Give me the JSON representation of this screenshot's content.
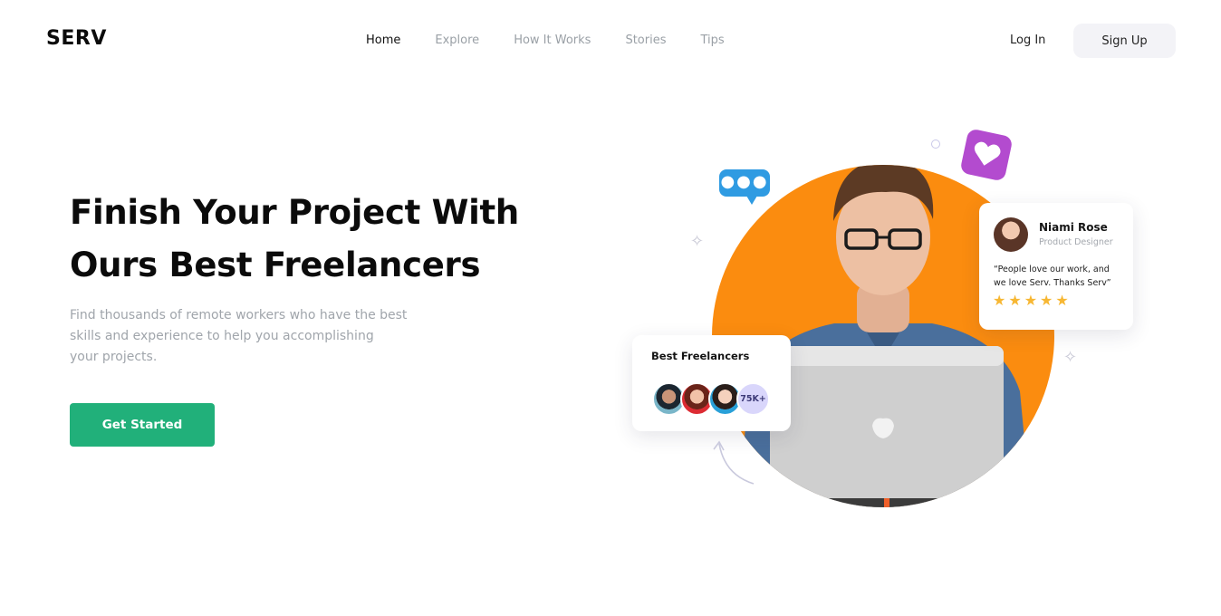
{
  "brand": {
    "logo": "SERV"
  },
  "nav": {
    "items": [
      {
        "label": "Home",
        "active": true
      },
      {
        "label": "Explore",
        "active": false
      },
      {
        "label": "How It Works",
        "active": false
      },
      {
        "label": "Stories",
        "active": false
      },
      {
        "label": "Tips",
        "active": false
      }
    ]
  },
  "auth": {
    "login_label": "Log In",
    "signup_label": "Sign Up"
  },
  "hero": {
    "headline_lines": [
      "Finish Your Project With",
      "Ours Best Freelancers"
    ],
    "subtitle_lines": [
      "Find thousands of remote workers who have the best",
      "skills and experience to help you accomplishing",
      "your projects."
    ],
    "cta_label": "Get Started"
  },
  "review": {
    "name": "Niami Rose",
    "role": "Product Designer",
    "quote_lines": [
      "“People love our work, and",
      "we love Serv. Thanks Serv”"
    ],
    "stars": "★★★★★",
    "rating": 5
  },
  "freelancers": {
    "title": "Best Freelancers",
    "count_badge": "75K+"
  },
  "colors": {
    "accent": "#21b07a",
    "orange": "#fb8c0f",
    "blue": "#2f9be2",
    "purple": "#b34bcf",
    "star": "#f7b733"
  },
  "icons": [
    "chat-bubble-icon",
    "heart-icon",
    "sparkle-icon",
    "arrow-icon",
    "star-icon"
  ]
}
